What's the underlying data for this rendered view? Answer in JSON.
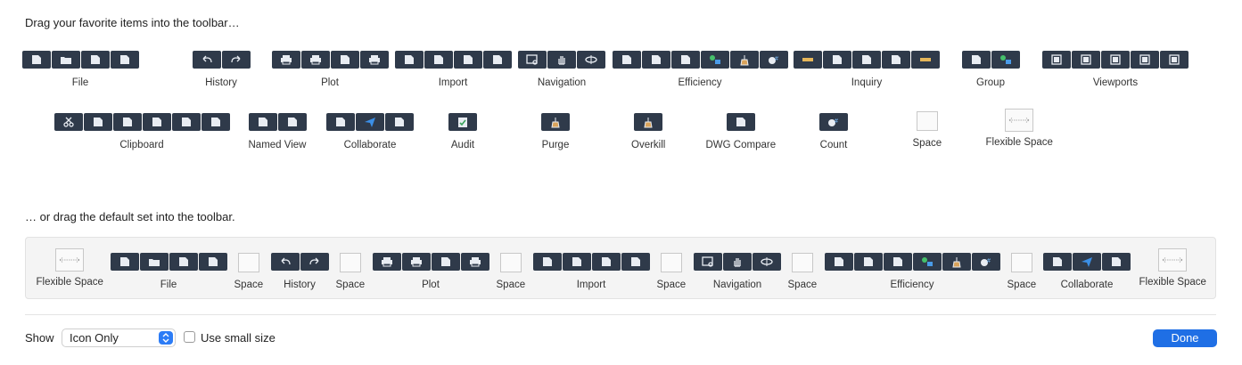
{
  "headings": {
    "favorites": "Drag your favorite items into the toolbar…",
    "default_set": "… or drag the default set into the toolbar."
  },
  "favorites": [
    {
      "label": "File",
      "kind": "group",
      "icons": [
        "new-file-icon",
        "open-folder-icon",
        "save-icon",
        "save-as-icon"
      ]
    },
    {
      "label": "History",
      "kind": "group",
      "icons": [
        "undo-icon",
        "redo-icon"
      ]
    },
    {
      "label": "Plot",
      "kind": "group",
      "icons": [
        "print-icon",
        "batch-plot-icon",
        "page-setup-icon",
        "plot-preview-icon"
      ]
    },
    {
      "label": "Import",
      "kind": "group",
      "icons": [
        "import-icon",
        "attach-icon",
        "pdf-import-icon",
        "image-import-icon"
      ]
    },
    {
      "label": "Navigation",
      "kind": "group",
      "icons": [
        "zoom-window-icon",
        "pan-hand-icon",
        "orbit-icon"
      ]
    },
    {
      "label": "Efficiency",
      "kind": "group",
      "icons": [
        "match-properties-icon",
        "quick-select-icon",
        "recover-icon",
        "group-objects-icon",
        "purge-icon",
        "count-icon"
      ]
    },
    {
      "label": "Inquiry",
      "kind": "group",
      "icons": [
        "distance-icon",
        "area-icon",
        "radius-icon",
        "angle-icon",
        "ruler-icon"
      ]
    },
    {
      "label": "Group",
      "kind": "group",
      "icons": [
        "group-bracket-icon",
        "ungroup-icon"
      ]
    },
    {
      "label": "Viewports",
      "kind": "group",
      "icons": [
        "viewport-rect-icon",
        "viewport-poly-icon",
        "viewport-object-icon",
        "viewport-new-icon",
        "viewport-clip-icon"
      ]
    },
    {
      "label": "Clipboard",
      "kind": "group",
      "icons": [
        "cut-icon",
        "copy-base-icon",
        "copy-link-icon",
        "paste-icon",
        "paste-block-icon",
        "paste-special-icon"
      ]
    },
    {
      "label": "Named View",
      "kind": "group",
      "icons": [
        "named-view-icon",
        "view-manager-icon"
      ]
    },
    {
      "label": "Collaborate",
      "kind": "group",
      "icons": [
        "dwg-compare-icon",
        "share-send-icon",
        "markup-icon"
      ]
    },
    {
      "label": "Audit",
      "kind": "group",
      "icons": [
        "audit-check-icon"
      ]
    },
    {
      "label": "Purge",
      "kind": "group",
      "icons": [
        "purge-broom-icon"
      ]
    },
    {
      "label": "Overkill",
      "kind": "group",
      "icons": [
        "overkill-broom-icon"
      ]
    },
    {
      "label": "DWG Compare",
      "kind": "group",
      "icons": [
        "dwg-compare-icon"
      ]
    },
    {
      "label": "Count",
      "kind": "group",
      "icons": [
        "count-icon"
      ]
    },
    {
      "label": "Space",
      "kind": "space",
      "icons": []
    },
    {
      "label": "Flexible Space",
      "kind": "flex",
      "icons": []
    }
  ],
  "default_set": [
    {
      "label": "Flexible Space",
      "kind": "flex",
      "icons": []
    },
    {
      "label": "File",
      "kind": "group",
      "icons": [
        "new-file-icon",
        "open-folder-icon",
        "save-icon",
        "save-as-icon"
      ]
    },
    {
      "label": "Space",
      "kind": "space",
      "icons": []
    },
    {
      "label": "History",
      "kind": "group",
      "icons": [
        "undo-icon",
        "redo-icon"
      ]
    },
    {
      "label": "Space",
      "kind": "space",
      "icons": []
    },
    {
      "label": "Plot",
      "kind": "group",
      "icons": [
        "print-icon",
        "batch-plot-icon",
        "page-setup-icon",
        "plot-preview-icon"
      ]
    },
    {
      "label": "Space",
      "kind": "space",
      "icons": []
    },
    {
      "label": "Import",
      "kind": "group",
      "icons": [
        "import-icon",
        "attach-icon",
        "pdf-import-icon",
        "image-import-icon"
      ]
    },
    {
      "label": "Space",
      "kind": "space",
      "icons": []
    },
    {
      "label": "Navigation",
      "kind": "group",
      "icons": [
        "zoom-window-icon",
        "pan-hand-icon",
        "orbit-icon"
      ]
    },
    {
      "label": "Space",
      "kind": "space",
      "icons": []
    },
    {
      "label": "Efficiency",
      "kind": "group",
      "icons": [
        "match-properties-icon",
        "quick-select-icon",
        "recover-icon",
        "group-objects-icon",
        "purge-icon",
        "count-icon"
      ]
    },
    {
      "label": "Space",
      "kind": "space",
      "icons": []
    },
    {
      "label": "Collaborate",
      "kind": "group",
      "icons": [
        "dwg-compare-icon",
        "share-send-icon",
        "markup-icon"
      ]
    },
    {
      "label": "Flexible Space",
      "kind": "flex",
      "icons": []
    }
  ],
  "footer": {
    "show_label": "Show",
    "show_value": "Icon Only",
    "small_size_label": "Use small size",
    "small_size_checked": false,
    "done_label": "Done"
  },
  "colors": {
    "icon_bg": "#2f3a4a",
    "accent": "#1f6fe5"
  }
}
